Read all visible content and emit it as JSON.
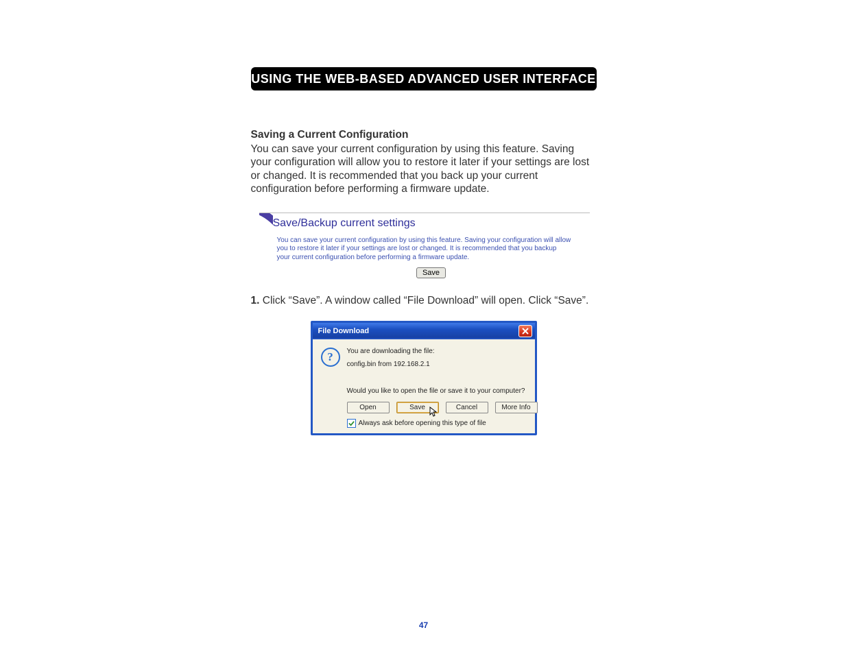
{
  "header": {
    "title": "USING THE WEB-BASED ADVANCED USER INTERFACE"
  },
  "section": {
    "heading": "Saving a Current Configuration",
    "body": "You can save your current configuration by using this feature. Saving your configuration will allow you to restore it later if your settings are lost or changed. It is recommended that you back up your current configuration before performing a firmware update."
  },
  "panel": {
    "title": "Save/Backup current settings",
    "desc": "You can save your current configuration by using this feature. Saving your configuration will allow you to restore it later if your settings are lost or changed. It is recommended that you backup your current configuration before performing a firmware update.",
    "save_label": "Save"
  },
  "step1": {
    "num": "1.",
    "text": " Click “Save”. A window called “File Download” will open. Click “Save”."
  },
  "dialog": {
    "title": "File Download",
    "line1": "You are downloading the file:",
    "line2": "config.bin from 192.168.2.1",
    "line3": "Would you like to open the file or save it to your computer?",
    "buttons": {
      "open": "Open",
      "save": "Save",
      "cancel": "Cancel",
      "more": "More Info"
    },
    "checkbox_label": "Always ask before opening this type of file",
    "checkbox_checked": true
  },
  "page_number": "47"
}
